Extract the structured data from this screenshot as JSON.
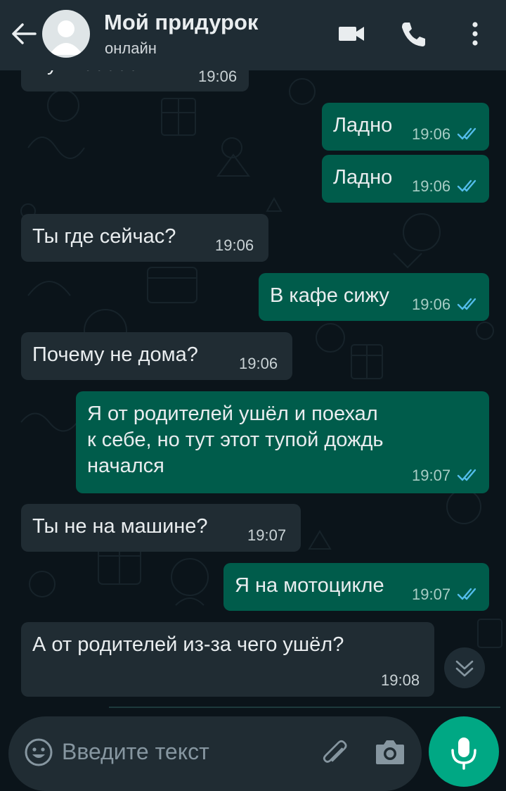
{
  "header": {
    "contact_name": "Мой придурок",
    "status": "онлайн",
    "background_color": "#1f2c34"
  },
  "messages": [
    {
      "direction": "incoming",
      "text": "Ну хвааааати",
      "time": "19:06",
      "partially_hidden": true
    },
    {
      "direction": "outgoing",
      "text": "Ладно",
      "time": "19:06",
      "read": true
    },
    {
      "direction": "outgoing",
      "text": "Ладно",
      "time": "19:06",
      "read": true
    },
    {
      "direction": "incoming",
      "text": "Ты где сейчас?",
      "time": "19:06"
    },
    {
      "direction": "outgoing",
      "text": "В кафе сижу",
      "time": "19:06",
      "read": true
    },
    {
      "direction": "incoming",
      "text": "Почему не дома?",
      "time": "19:06"
    },
    {
      "direction": "outgoing",
      "lines": [
        "Я от родителей ушёл и поехал",
        "к себе, но тут этот тупой дождь",
        "начался"
      ],
      "time": "19:07",
      "read": true
    },
    {
      "direction": "incoming",
      "text": "Ты не на машине?",
      "time": "19:07"
    },
    {
      "direction": "outgoing",
      "text": "Я на мотоцикле",
      "time": "19:07",
      "read": true
    },
    {
      "direction": "incoming",
      "text": "А от родителей из-за чего ушёл?",
      "time": "19:08"
    }
  ],
  "composer": {
    "placeholder": "Введите текст",
    "icons": [
      "emoji-icon",
      "paperclip-icon",
      "camera-icon",
      "microphone-icon"
    ]
  },
  "icons": {
    "header": [
      "back-arrow-icon",
      "avatar",
      "video-camera-icon",
      "phone-icon",
      "more-vertical-icon"
    ],
    "read_receipt": "double-check-icon",
    "scroll": "chevron-double-down-icon"
  },
  "colors": {
    "background": "#0b141a",
    "incoming_bubble": "#202c33",
    "outgoing_bubble": "#005c4b",
    "read_tick": "#53bdeb",
    "accent": "#00a884",
    "text": "#e9edef"
  }
}
